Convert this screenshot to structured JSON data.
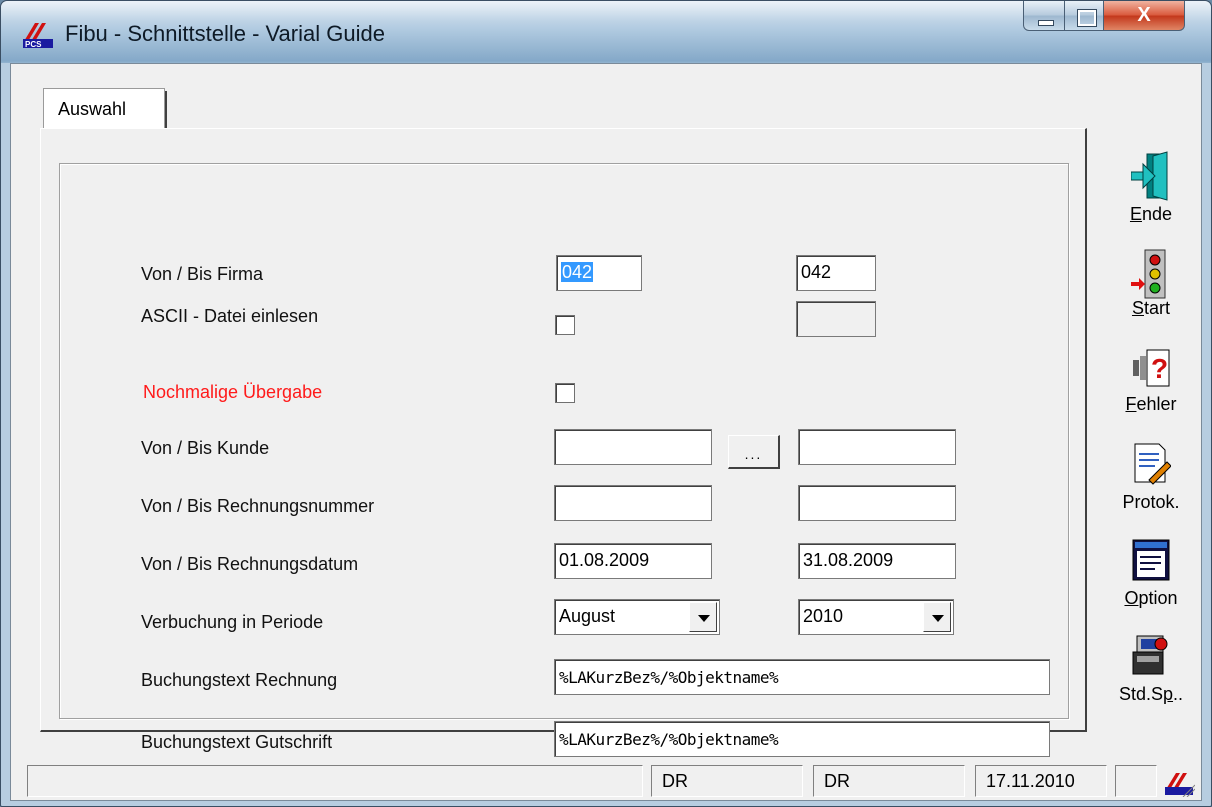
{
  "window": {
    "title": "Fibu - Schnittstelle - Varial Guide",
    "close_glyph": "X"
  },
  "tabs": [
    {
      "label": "Auswahl"
    }
  ],
  "form": {
    "firma": {
      "label": "Von / Bis Firma",
      "from": "042",
      "to": "042"
    },
    "ascii": {
      "label": "ASCII - Datei einlesen",
      "checked": false,
      "path": ""
    },
    "nochmalig": {
      "label": "Nochmalige Übergabe",
      "checked": false,
      "color": "#ff1a1a"
    },
    "kunde": {
      "label": "Von / Bis Kunde",
      "from": "",
      "to": "",
      "browse_label": "..."
    },
    "rechnungsnummer": {
      "label": "Von / Bis Rechnungsnummer",
      "from": "",
      "to": ""
    },
    "rechnungsdatum": {
      "label": "Von / Bis Rechnungsdatum",
      "from": "01.08.2009",
      "to": "31.08.2009"
    },
    "periode": {
      "label": "Verbuchung in Periode",
      "month": "August",
      "year": "2010"
    },
    "text_rechnung": {
      "label": "Buchungstext Rechnung",
      "value": "%LAKurzBez%/%Objektname%"
    },
    "text_gutschrift": {
      "label": "Buchungstext Gutschrift",
      "value": "%LAKurzBez%/%Objektname%"
    }
  },
  "toolbar": [
    {
      "name": "ende",
      "mnemonic": "E",
      "rest": "nde",
      "icon": "exit-door-icon"
    },
    {
      "name": "start",
      "mnemonic": "S",
      "rest": "tart",
      "icon": "traffic-light-icon"
    },
    {
      "name": "fehler",
      "mnemonic": "F",
      "rest": "ehler",
      "icon": "error-help-icon"
    },
    {
      "name": "protok",
      "mnemonic": "",
      "rest": "Protok.",
      "icon": "protocol-document-icon"
    },
    {
      "name": "option",
      "mnemonic": "O",
      "rest": "ption",
      "icon": "options-window-icon"
    },
    {
      "name": "stdsp",
      "mnemonic": "",
      "rest": "Std.S",
      "suffix_ul": "p",
      "suffix": "..",
      "icon": "standard-save-icon"
    }
  ],
  "statusbar": {
    "panel1": "",
    "user1": "DR",
    "user2": "DR",
    "date": "17.11.2010",
    "panel5": ""
  }
}
